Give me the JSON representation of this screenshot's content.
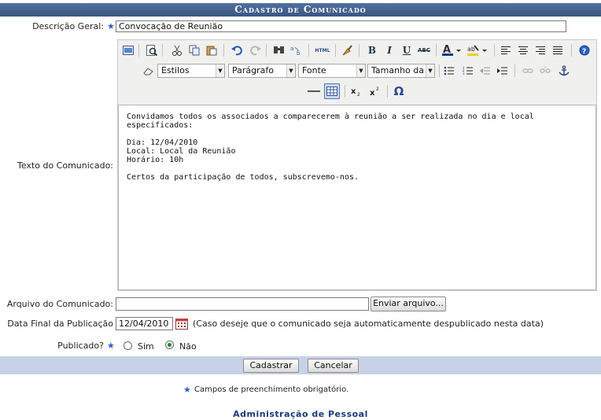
{
  "title": "Cadastro de Comunicado",
  "descricao": {
    "label": "Descrição Geral:",
    "value": "Convocação de Reunião"
  },
  "texto": {
    "label": "Texto do Comunicado:",
    "toolbar": {
      "estilos": "Estilos",
      "paragrafo": "Parágrafo",
      "fonte": "Fonte",
      "tamanho": "Tamanho da Fo",
      "bold": "B",
      "italic": "I",
      "underline": "U",
      "strike": "ABC",
      "html": "HTML",
      "omega": "Ω"
    },
    "paragraphs": [
      "Convidamos todos os associados a comparecerem à reunião a ser realizada no dia e local\nespecificados:",
      "Dia: 12/04/2010\nLocal: Local da Reunião\nHorário: 10h",
      "Certos da participação de todos, subscrevemo-nos."
    ]
  },
  "arquivo": {
    "label": "Arquivo do Comunicado:",
    "value": "",
    "button": "Enviar arquivo..."
  },
  "data_final": {
    "label": "Data Final da Publicação",
    "value": "12/04/2010",
    "hint": "(Caso deseje que o comunicado seja automaticamente despublicado nesta data)"
  },
  "publicado": {
    "label": "Publicado?",
    "options": [
      "Sim",
      "Não"
    ],
    "selected": "Não"
  },
  "buttons": {
    "cadastrar": "Cadastrar",
    "cancelar": "Cancelar"
  },
  "required_note": "Campos de preenchimento obrigatório.",
  "footer_link": "Administração de Pessoal",
  "colors": {
    "title_bg": "#3a5683",
    "footer_bar": "#c7d2e8",
    "required_star": "#2a62c9",
    "radio_selected": "#1a8a2a"
  }
}
